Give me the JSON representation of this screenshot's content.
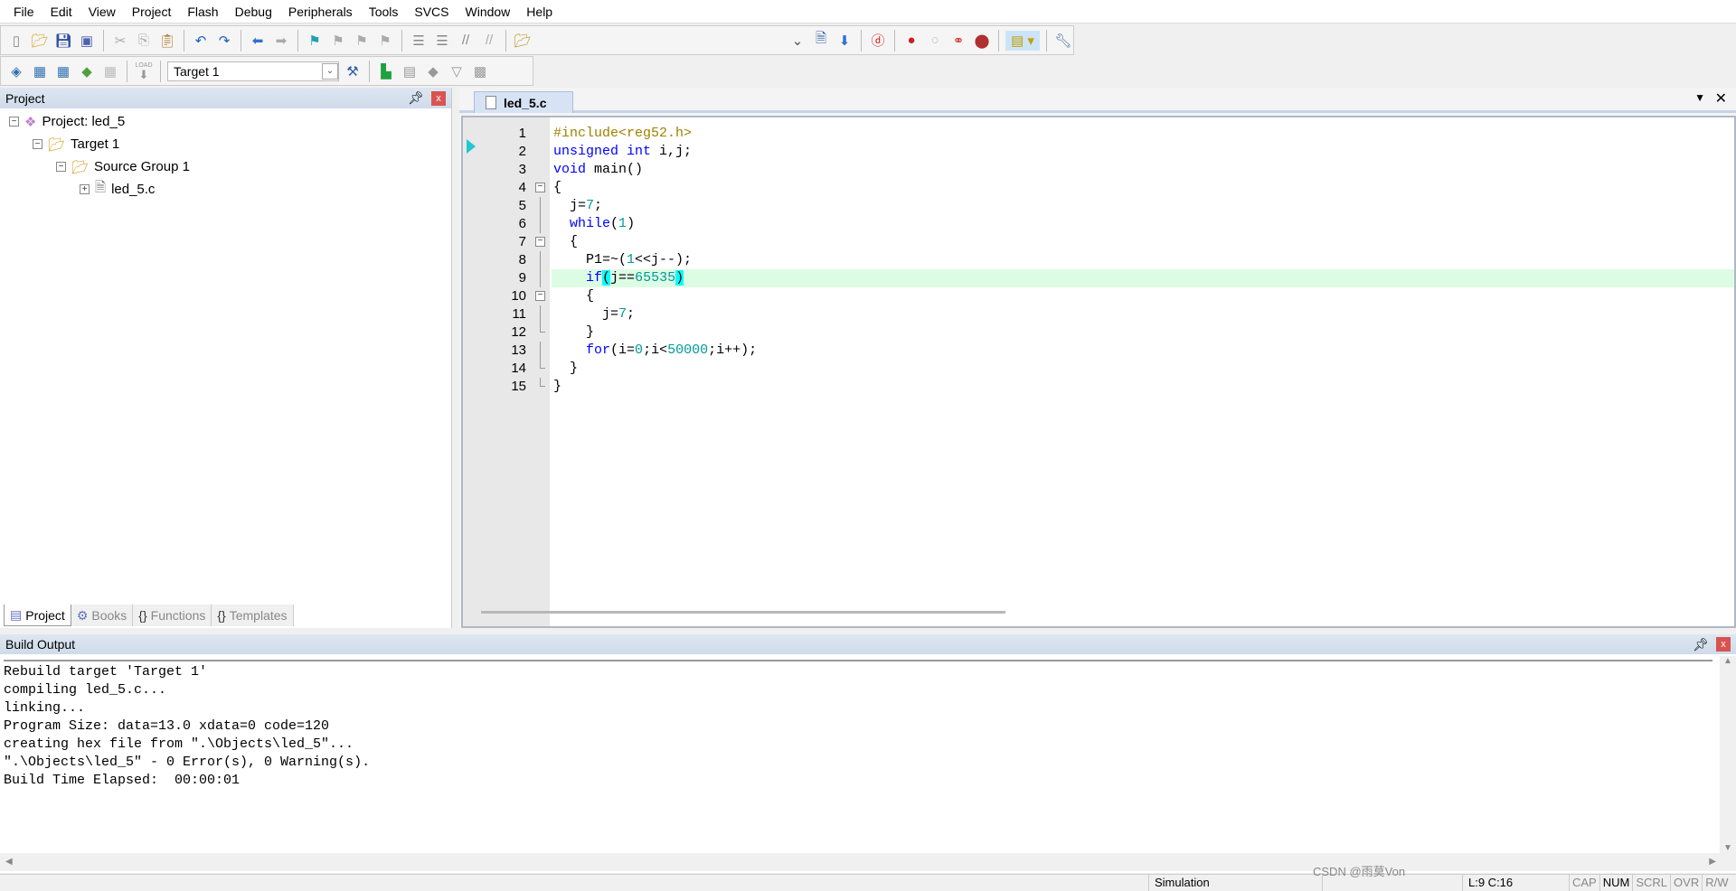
{
  "menu": [
    "File",
    "Edit",
    "View",
    "Project",
    "Flash",
    "Debug",
    "Peripherals",
    "Tools",
    "SVCS",
    "Window",
    "Help"
  ],
  "toolbar1": {
    "icons": [
      "new-file-icon",
      "open-folder-icon",
      "save-icon",
      "save-all-icon",
      "|",
      "cut-icon",
      "copy-icon",
      "paste-icon",
      "|",
      "undo-icon",
      "redo-icon",
      "|",
      "navigate-back-icon",
      "navigate-forward-icon",
      "|",
      "bookmark-icon",
      "prev-bookmark-icon",
      "next-bookmark-icon",
      "clear-bookmarks-icon",
      "|",
      "indent-icon",
      "unindent-icon",
      "comment-icon",
      "uncomment-icon",
      "|",
      "find-in-files-icon"
    ],
    "right_icons": [
      "find-dropdown-icon",
      "incremental-find-icon",
      "source-browser-icon",
      "|",
      "debug-session-icon",
      "|",
      "breakpoint-icon",
      "disable-breakpoint-icon",
      "disable-all-breakpoints-icon",
      "kill-breakpoints-icon",
      "|",
      "window-layout-icon",
      "|",
      "configure-icon"
    ]
  },
  "toolbar2": {
    "icons": [
      "translate-icon",
      "build-icon",
      "rebuild-icon",
      "batch-build-icon",
      "stop-build-icon",
      "|",
      "download-icon",
      "|"
    ],
    "target": "Target 1",
    "after_icons": [
      "target-options-icon",
      "|",
      "manage-components-icon",
      "select-packs-icon",
      "pack-installer-icon",
      "filter-icon",
      "rte-icon"
    ],
    "load_label": "LOAD"
  },
  "project_panel": {
    "title": "Project",
    "tree": [
      {
        "label": "Project: led_5",
        "level": 0,
        "toggle": "−",
        "icon": "project-icon"
      },
      {
        "label": "Target 1",
        "level": 1,
        "toggle": "−",
        "icon": "target-folder-icon"
      },
      {
        "label": "Source Group 1",
        "level": 2,
        "toggle": "−",
        "icon": "folder-icon"
      },
      {
        "label": "led_5.c",
        "level": 3,
        "toggle": "+",
        "icon": "c-file-icon"
      }
    ],
    "tabs": [
      "Project",
      "Books",
      "Functions",
      "Templates"
    ]
  },
  "editor": {
    "tab": "led_5.c",
    "current_line": 9,
    "lines": [
      "#include<reg52.h>",
      "unsigned int i,j;",
      "void main()",
      "{",
      "  j=7;",
      "  while(1)",
      "  {",
      "    P1=~(1<<j--);",
      "    if(j==65535)",
      "    {",
      "      j=7;",
      "    }",
      "    for(i=0;i<50000;i++);",
      "  }",
      "}"
    ]
  },
  "build_output": {
    "title": "Build Output",
    "lines": [
      "Rebuild target 'Target 1'",
      "compiling led_5.c...",
      "linking...",
      "Program Size: data=13.0 xdata=0 code=120",
      "creating hex file from \".\\Objects\\led_5\"...",
      "\".\\Objects\\led_5\" - 0 Error(s), 0 Warning(s).",
      "Build Time Elapsed:  00:00:01"
    ]
  },
  "status": {
    "mode": "Simulation",
    "position": "L:9 C:16",
    "flags": [
      "CAP",
      "NUM",
      "SCRL",
      "OVR",
      "R/W"
    ],
    "watermark": "CSDN @雨莫Von"
  }
}
